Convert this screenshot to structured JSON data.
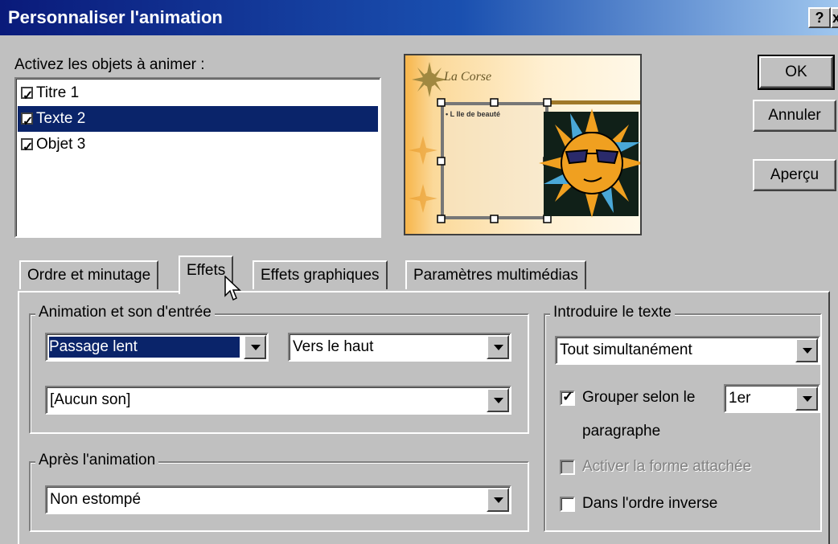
{
  "window": {
    "title": "Personnaliser l'animation",
    "help_btn": "?",
    "close_btn": "x"
  },
  "objects": {
    "label": "Activez les objets à animer :",
    "items": [
      {
        "label": "Titre 1",
        "checked": true,
        "selected": false
      },
      {
        "label": "Texte 2",
        "checked": true,
        "selected": true
      },
      {
        "label": "Objet 3",
        "checked": true,
        "selected": false
      }
    ]
  },
  "preview": {
    "slide_title": "La Corse",
    "bullet_text": "• L Ile de beauté"
  },
  "buttons": {
    "ok": "OK",
    "cancel": "Annuler",
    "preview": "Aperçu"
  },
  "tabs": [
    {
      "label": "Ordre et minutage",
      "active": false
    },
    {
      "label": "Effets",
      "active": true
    },
    {
      "label": "Effets graphiques",
      "active": false
    },
    {
      "label": "Paramètres multimédias",
      "active": false
    }
  ],
  "entry": {
    "legend": "Animation et son d'entrée",
    "effect": "Passage lent",
    "direction": "Vers le haut",
    "sound": "[Aucun son]"
  },
  "after": {
    "legend": "Après l'animation",
    "value": "Non estompé"
  },
  "introduce": {
    "legend": "Introduire le texte",
    "mode": "Tout simultanément",
    "group_by_label": "Grouper selon le",
    "group_by_value": "1er",
    "group_by_checked": true,
    "paragraph_label": "paragraphe",
    "attach_label": "Activer la forme attachée",
    "attach_checked": false,
    "reverse_label": "Dans l'ordre inverse",
    "reverse_checked": false
  }
}
